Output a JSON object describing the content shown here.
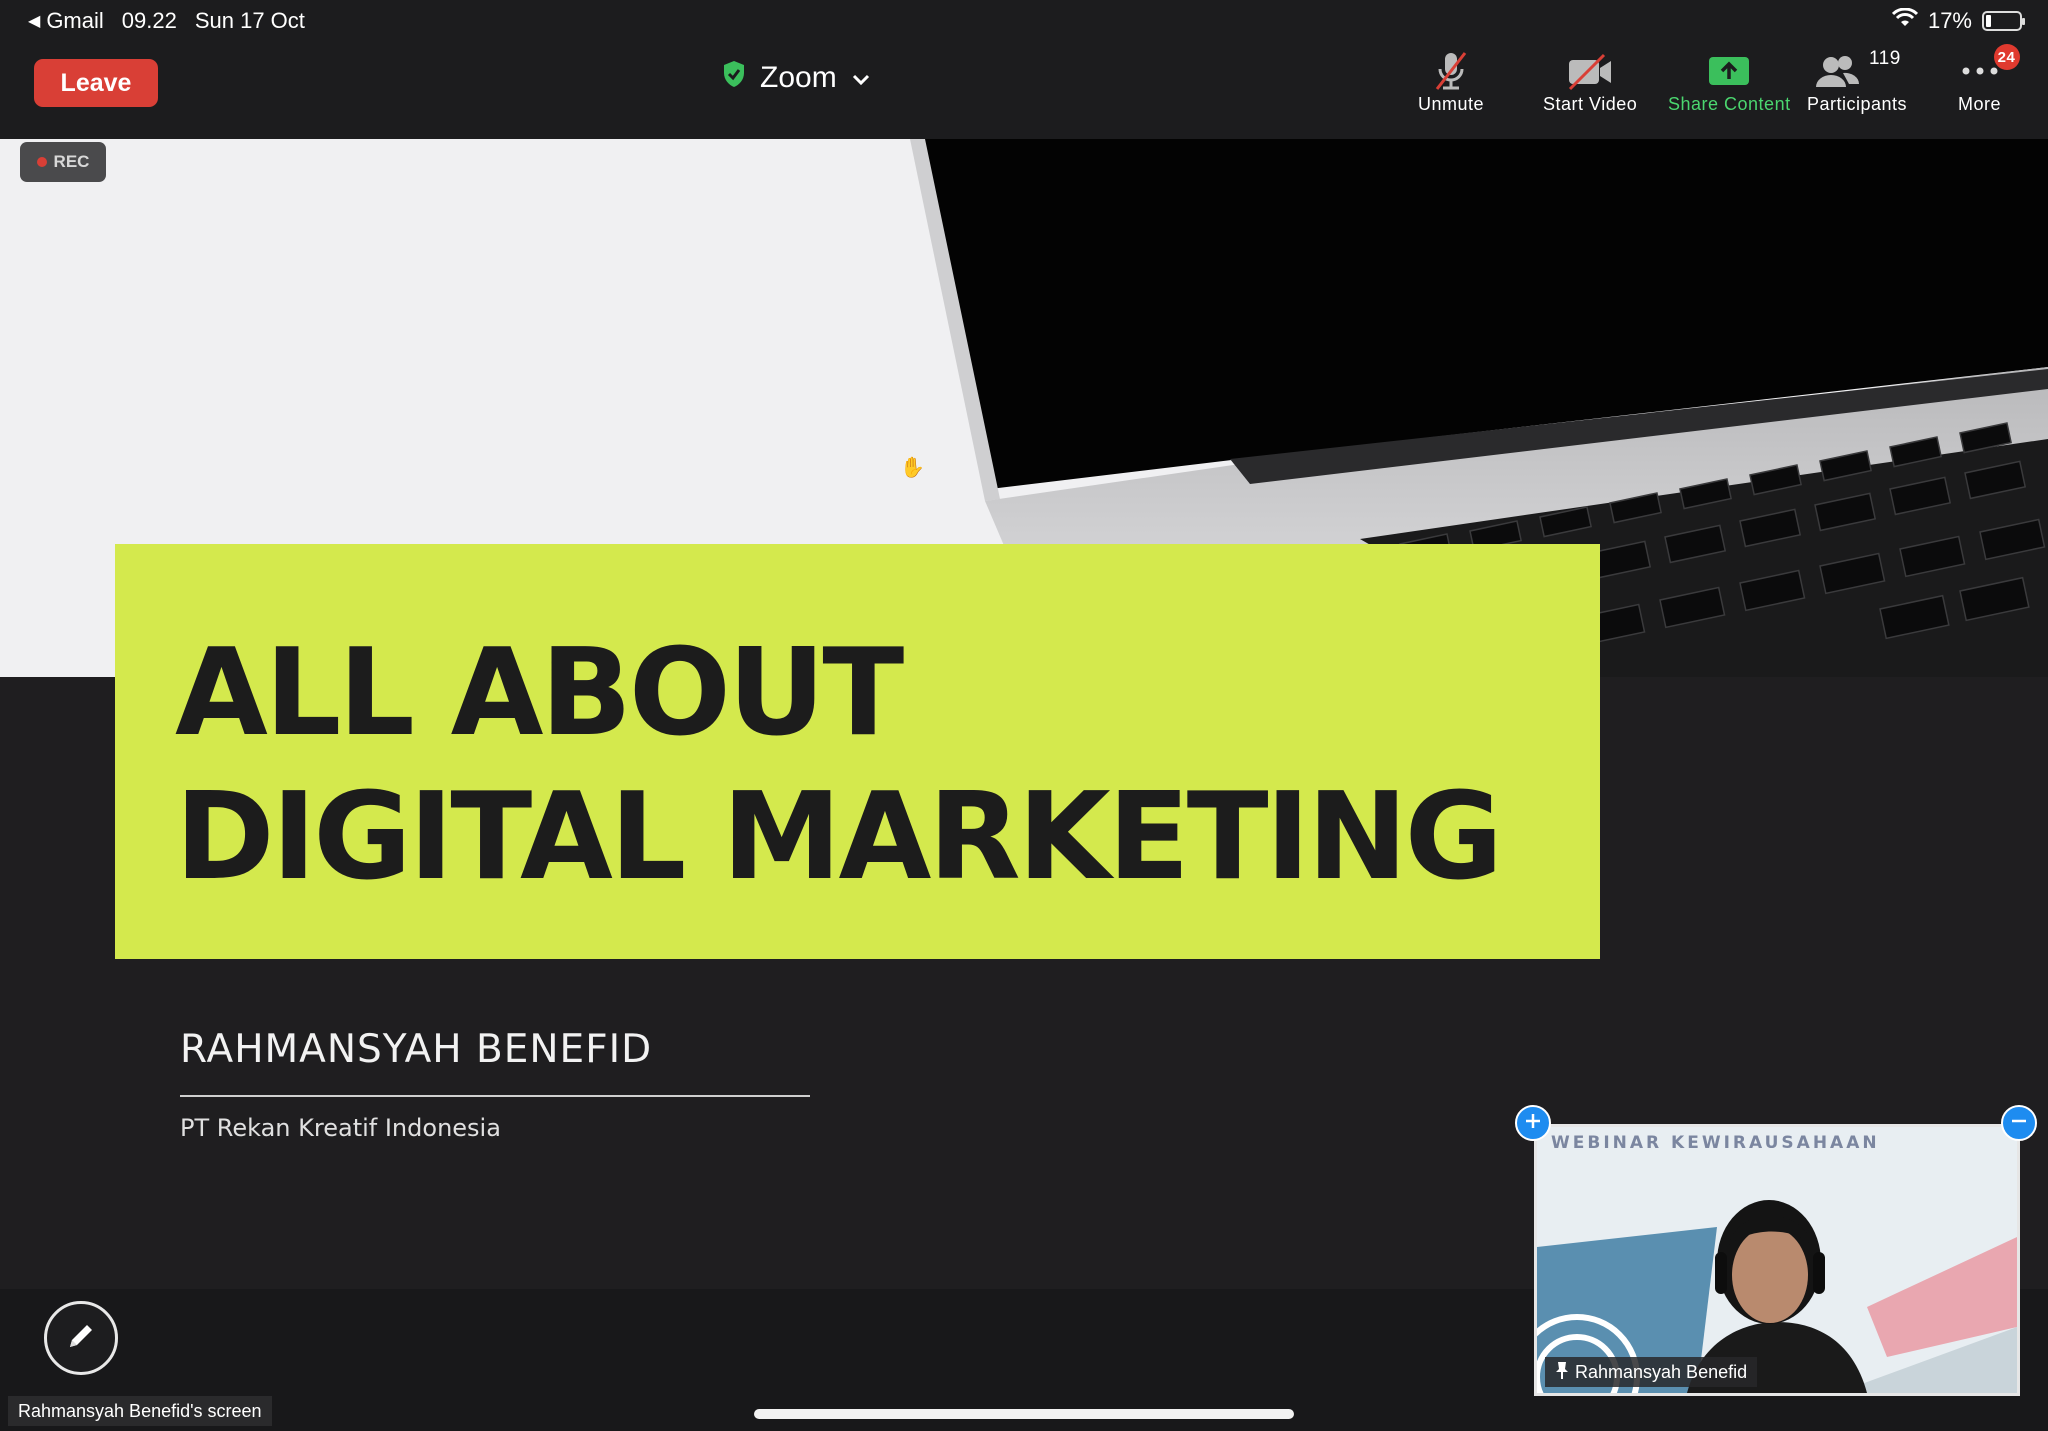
{
  "status_bar": {
    "back_app": "Gmail",
    "time": "09.22",
    "date": "Sun 17 Oct",
    "battery": "17%",
    "battery_level": 0.17
  },
  "toolbar": {
    "leave_label": "Leave",
    "meeting_title": "Zoom",
    "unmute_label": "Unmute",
    "start_video_label": "Start Video",
    "share_content_label": "Share Content",
    "participants_label": "Participants",
    "participants_count": "119",
    "more_label": "More",
    "more_badge": "24"
  },
  "recording": {
    "label": "REC"
  },
  "slide": {
    "title": "ALL ABOUT\nDIGITAL MARKETING",
    "presenter": "RAHMANSYAH BENEFID",
    "company": "PT Rekan Kreatif Indonesia"
  },
  "thumbnail": {
    "banner": "WEBINAR KEWIRAUSAHAAN",
    "name": "Rahmansyah Benefid"
  },
  "screen_label": "Rahmansyah Benefid's screen",
  "colors": {
    "leave": "#d93f36",
    "share_accent": "#4bd66f",
    "slide_accent": "#d4e94d",
    "badge": "#e03a2f"
  }
}
